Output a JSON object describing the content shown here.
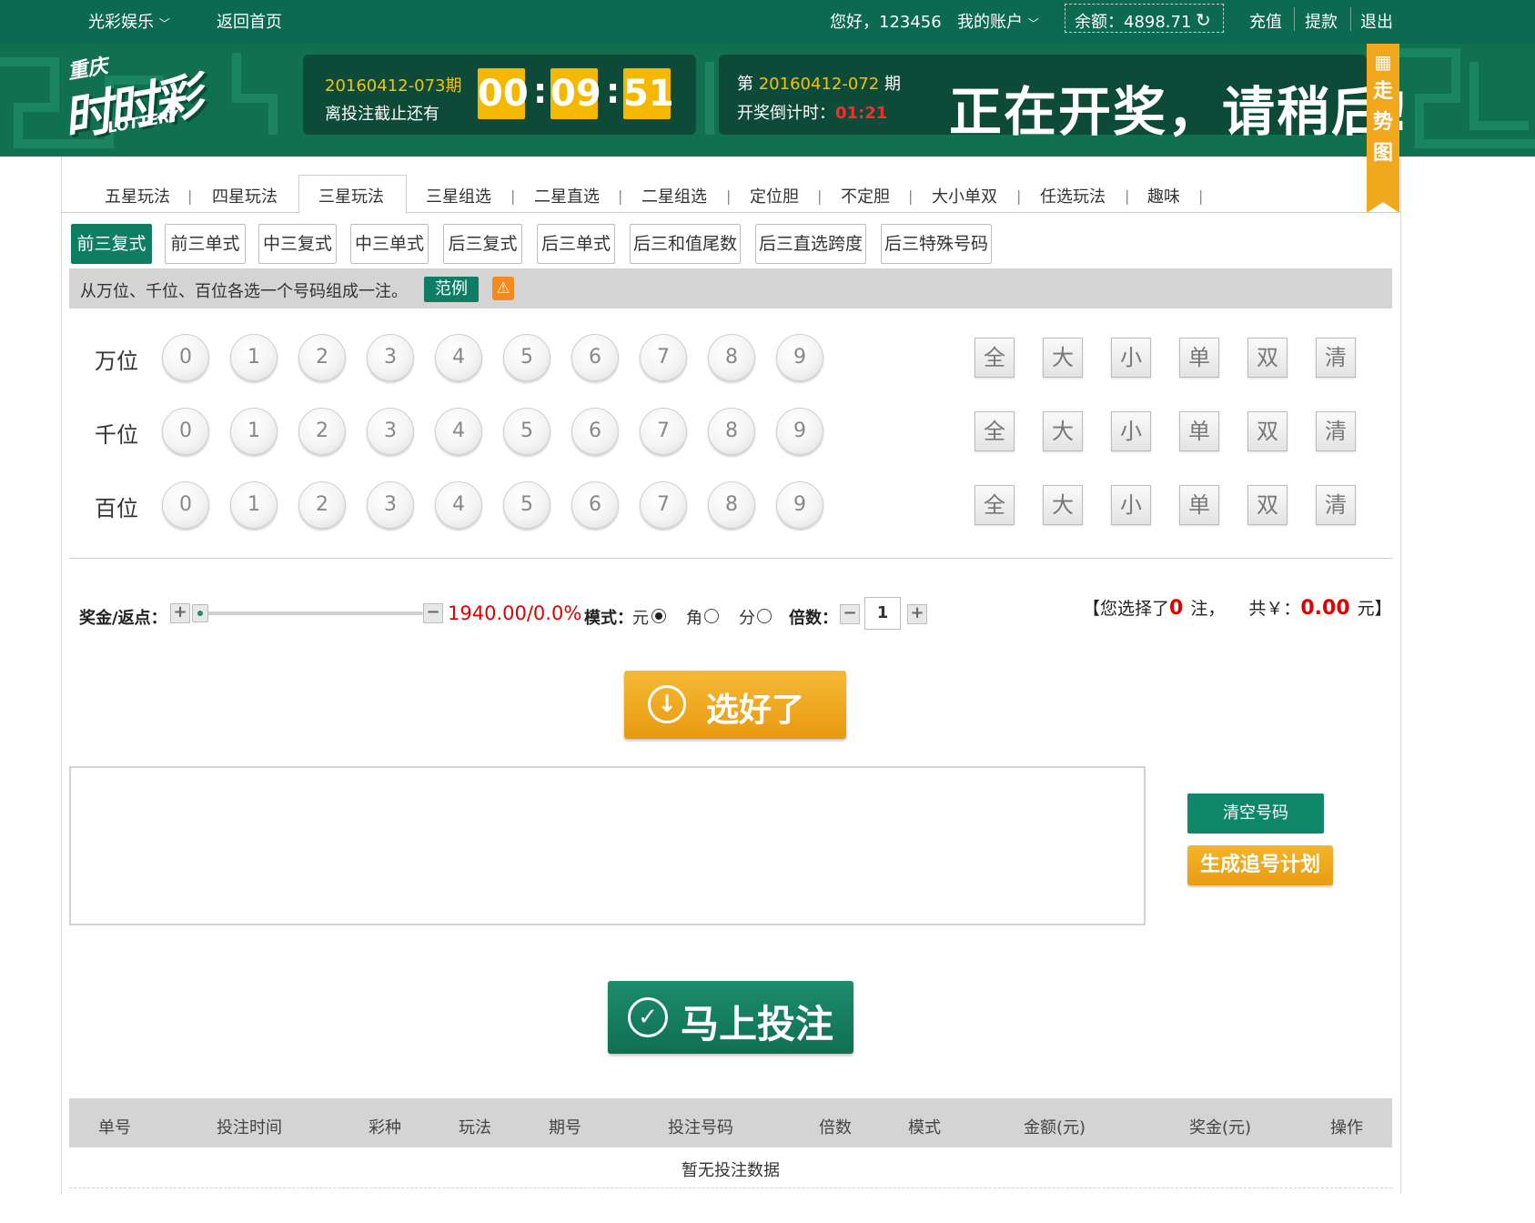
{
  "topbar": {
    "brand": "光彩娱乐",
    "home": "返回首页",
    "greeting": "您好，123456",
    "account": "我的账户",
    "balance_label": "余额：4898.71",
    "recharge": "充值",
    "withdraw": "提款",
    "logout": "退出"
  },
  "header": {
    "logo_top": "重庆",
    "logo_main": "时时彩",
    "logo_sub": "LOTTERY",
    "current_issue": "20160412-073期",
    "deadline_label": "离投注截止还有",
    "countdown": {
      "h": "00",
      "m": "09",
      "s": "51"
    },
    "last_issue_prefix": "第",
    "last_issue": "20160412-072",
    "last_issue_suffix": "期",
    "draw_countdown_label": "开奖倒计时：",
    "draw_countdown": "01:21",
    "drawing_message": "正在开奖，请稍后!",
    "trend_tab": [
      "走",
      "势",
      "图"
    ]
  },
  "tabs": [
    "五星玩法",
    "四星玩法",
    "三星玩法",
    "三星组选",
    "二星直选",
    "二星组选",
    "定位胆",
    "不定胆",
    "大小单双",
    "任选玩法",
    "趣味"
  ],
  "active_tab": "三星玩法",
  "subtabs": [
    "前三复式",
    "前三单式",
    "中三复式",
    "中三单式",
    "后三复式",
    "后三单式",
    "后三和值尾数",
    "后三直选跨度",
    "后三特殊号码"
  ],
  "active_subtab": "前三复式",
  "hint": {
    "text": "从万位、千位、百位各选一个号码组成一注。",
    "example": "范例"
  },
  "rows": [
    {
      "label": "万位"
    },
    {
      "label": "千位"
    },
    {
      "label": "百位"
    }
  ],
  "numbers": [
    "0",
    "1",
    "2",
    "3",
    "4",
    "5",
    "6",
    "7",
    "8",
    "9"
  ],
  "quick_buttons": [
    "全",
    "大",
    "小",
    "单",
    "双",
    "清"
  ],
  "settings": {
    "prize_label": "奖金/返点：",
    "prize_value": "1940.00/0.0%",
    "slider_position": 0,
    "mode_label": "模式：",
    "modes": [
      "元",
      "角",
      "分"
    ],
    "selected_mode": "元",
    "multiple_label": "倍数：",
    "multiple": "1",
    "summary_prefix": "【您选择了",
    "count": "0",
    "summary_mid": "注，",
    "total_prefix": "共￥：",
    "total": "0.00",
    "summary_suffix": "元】"
  },
  "buttons": {
    "pick": "选好了",
    "clear": "清空号码",
    "plan": "生成追号计划",
    "bet": "马上投注"
  },
  "table": {
    "headers": [
      "单号",
      "投注时间",
      "彩种",
      "玩法",
      "期号",
      "投注号码",
      "倍数",
      "模式",
      "金额(元)",
      "奖金(元)",
      "操作"
    ],
    "empty": "暂无投注数据"
  },
  "colors": {
    "primary_green": "#0b6a4f",
    "accent_orange": "#f2a81d",
    "highlight_red": "#e00000"
  }
}
